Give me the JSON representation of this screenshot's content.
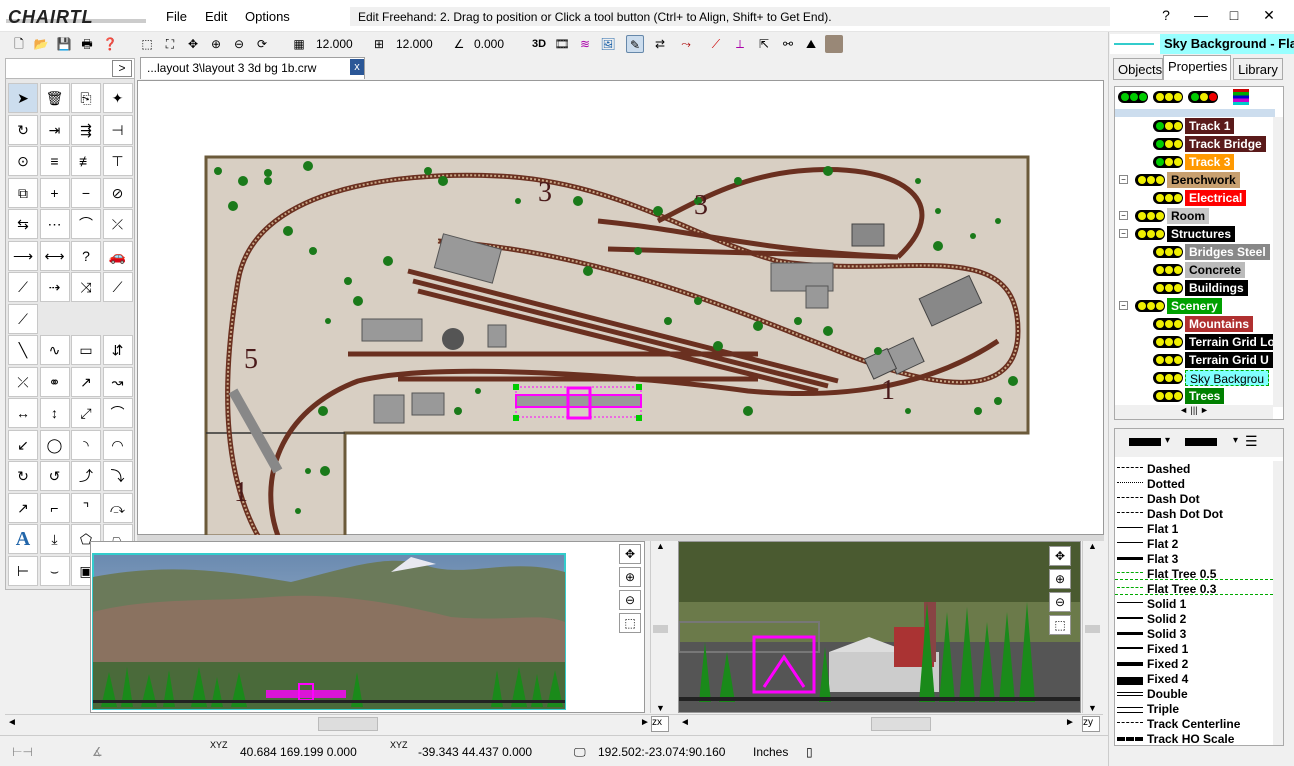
{
  "app": {
    "logo": "CHAIRTL"
  },
  "menu": [
    "File",
    "Edit",
    "Options"
  ],
  "status_message": "Edit Freehand:  2. Drag to position or Click a tool button (Ctrl+ to Align, Shift+ to Get End).",
  "window_buttons": [
    "?",
    "—",
    "□",
    "✕"
  ],
  "toolbar": {
    "grid_x": "12.000",
    "grid_y": "12.000",
    "angle": "0.000",
    "three_d": "3D"
  },
  "document_tab": "...layout 3\\layout 3 3d bg 1b.crw",
  "palette": {
    "collapse": ">"
  },
  "layout_labels": [
    "3",
    "3",
    "5",
    "1",
    "1"
  ],
  "statusbar": {
    "coords1": "40.684  169.199  0.000",
    "coords2": "-39.343  44.437  0.000",
    "coords3": "192.502:-23.074:90.160",
    "units": "Inches",
    "xyz1": "XYZ",
    "xyz2": "XYZ"
  },
  "right_panel": {
    "selected_name": "Sky Background - Fla",
    "tabs": [
      "Objects",
      "Properties",
      "Library"
    ],
    "layers": [
      {
        "name": "Track 1",
        "bg": "#5a1a1a",
        "fg": "#ffffff",
        "indent": 2
      },
      {
        "name": "Track Bridge",
        "bg": "#5a1a1a",
        "fg": "#ffffff",
        "indent": 2
      },
      {
        "name": "Track 3",
        "bg": "#ff9900",
        "fg": "#ffffff",
        "indent": 2
      },
      {
        "name": "Benchwork",
        "bg": "#c8a070",
        "fg": "#000000",
        "indent": 1
      },
      {
        "name": "Electrical",
        "bg": "#ff0000",
        "fg": "#ffffff",
        "indent": 2
      },
      {
        "name": "Room",
        "bg": "#c8c8c8",
        "fg": "#000000",
        "indent": 1
      },
      {
        "name": "Structures",
        "bg": "#000000",
        "fg": "#ffffff",
        "indent": 1
      },
      {
        "name": "Bridges Steel",
        "bg": "#888888",
        "fg": "#ffffff",
        "indent": 2
      },
      {
        "name": "Concrete",
        "bg": "#bbbbbb",
        "fg": "#000000",
        "indent": 2
      },
      {
        "name": "Buildings",
        "bg": "#000000",
        "fg": "#ffffff",
        "indent": 2
      },
      {
        "name": "Scenery",
        "bg": "#00a000",
        "fg": "#ffffff",
        "indent": 1
      },
      {
        "name": "Mountains",
        "bg": "#b03030",
        "fg": "#ffffff",
        "indent": 2
      },
      {
        "name": "Terrain Grid Lo",
        "bg": "#000000",
        "fg": "#ffffff",
        "indent": 2
      },
      {
        "name": "Terrain Grid U",
        "bg": "#000000",
        "fg": "#ffffff",
        "indent": 2
      },
      {
        "name": "Sky Backgrou",
        "bg": "#80ffff",
        "fg": "#000000",
        "indent": 2
      },
      {
        "name": "Trees",
        "bg": "#008000",
        "fg": "#ffffff",
        "indent": 2
      }
    ],
    "line_styles": [
      "Dashed",
      "Dotted",
      "Dash Dot",
      "Dash Dot Dot",
      "Flat 1",
      "Flat 2",
      "Flat 3",
      "Flat Tree 0.5",
      "Flat Tree 0.3",
      "Solid 1",
      "Solid 2",
      "Solid 3",
      "Fixed 1",
      "Fixed 2",
      "Fixed 4",
      "Double",
      "Triple",
      "Track Centerline",
      "Track HO Scale"
    ]
  }
}
